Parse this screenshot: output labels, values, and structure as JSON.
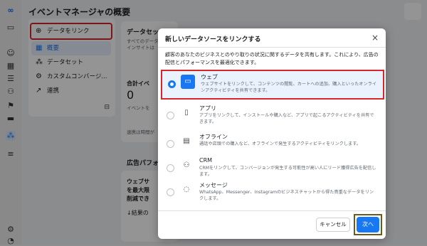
{
  "app": {
    "page_title": "イベントマネージャの概要",
    "rail_icons": [
      "meta-logo-icon",
      "panel-icon",
      "smile-icon",
      "grid-icon",
      "list-icon",
      "people-icon",
      "flag-icon",
      "card-icon",
      "datasources-icon",
      "menu-icon",
      "settings-icon",
      "bell-icon"
    ]
  },
  "sidebar": {
    "items": [
      {
        "label": "データをリンク",
        "icon": "add-circle-icon"
      },
      {
        "label": "概要",
        "icon": "overview-icon"
      },
      {
        "label": "データセット",
        "icon": "dataset-icon"
      },
      {
        "label": "カスタムコンバージ...",
        "icon": "custom-conversion-icon"
      },
      {
        "label": "連携",
        "icon": "integration-icon"
      }
    ]
  },
  "background": {
    "dataset_card_title": "データセッ",
    "dataset_card_line1": "すべてのデータ",
    "dataset_card_line2": "インサイトは",
    "total_label": "合計イベ",
    "total_value": "0",
    "total_sub": "イベントを",
    "usage_note": "速携は時間が",
    "ad_perf_title": "広告パフォ",
    "web_card_line1": "ウェブサ",
    "web_card_line2": "を最大限",
    "web_card_line3": "削減でき",
    "result_link": "結果の"
  },
  "modal": {
    "title": "新しいデータソースをリンクする",
    "close_label": "×",
    "description": "顧客のあなたのビジネスとのやり取りの状況に関するデータを共有します。これにより、広告の配信とパフォーマンスを最適化できます。",
    "options": [
      {
        "title": "ウェブ",
        "desc": "ウェブサイトをリンクして、コンテンツの閲覧、カートへの追加、購入といったオンラインアクティビティを共有できます。",
        "icon": "laptop-icon",
        "selected": true
      },
      {
        "title": "アプリ",
        "desc": "アプリをリンクして、インストールや購入など、アプリで起こるアクティビティを共有できます。",
        "icon": "phone-icon",
        "selected": false
      },
      {
        "title": "オフライン",
        "desc": "通話や店頭での購入など、オフラインで発生するアクティビティをリンクします。",
        "icon": "store-icon",
        "selected": false
      },
      {
        "title": "CRM",
        "desc": "CRMをリンクして、コンバージョンが発生する可能性が高い人にリード獲得広告を配信します。",
        "icon": "crm-icon",
        "selected": false
      },
      {
        "title": "メッセージ",
        "desc": "WhatsApp、Messenger、Instagramのビジネスチャットから得た貴重なデータをリンクします。",
        "icon": "chat-icon",
        "selected": false
      }
    ],
    "cancel_label": "キャンセル",
    "next_label": "次へ"
  },
  "colors": {
    "accent": "#1877f2",
    "highlight": "#d7262b",
    "selected_bg": "#eaf2fe"
  }
}
